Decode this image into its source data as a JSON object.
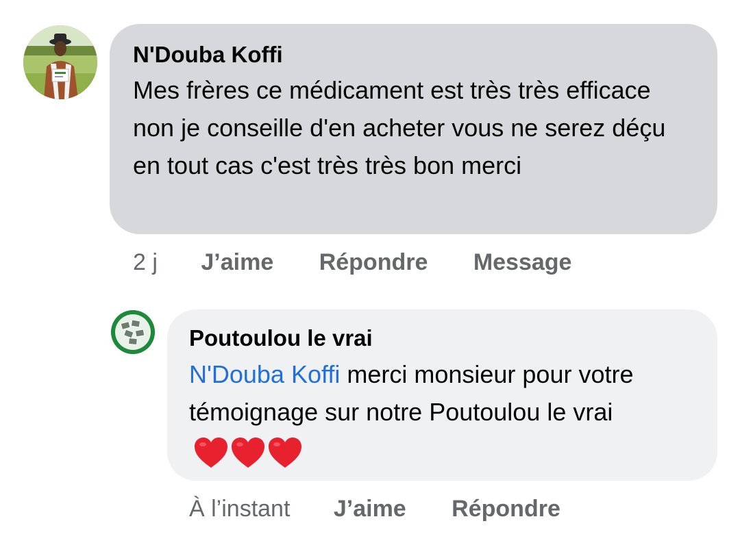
{
  "comments": [
    {
      "author": "N'Douba Koffi",
      "avatar_icon": "user-photo-avatar",
      "text": "Mes frères ce médicament est très très efficace non je conseille d'en acheter vous ne serez déçu en tout cas c'est très très bon merci",
      "timestamp": "2 j",
      "actions": {
        "like": "J’aime",
        "reply": "Répondre",
        "message": "Message"
      }
    }
  ],
  "reply": {
    "author": "Poutoulou le vrai",
    "avatar_icon": "page-logo-avatar",
    "mention": "N'Douba Koffi",
    "text": " merci monsieur pour votre témoignage sur notre Poutoulou le vrai",
    "emoji_icon": "red-heart-icon",
    "emoji_count": 3,
    "timestamp": "À l’instant",
    "actions": {
      "like": "J’aime",
      "reply": "Répondre"
    }
  },
  "colors": {
    "bubble_main": "#d7d8dc",
    "bubble_reply": "#f0f1f3",
    "meta_text": "#65676b",
    "mention": "#216fdb",
    "heart": "#e8212e"
  }
}
